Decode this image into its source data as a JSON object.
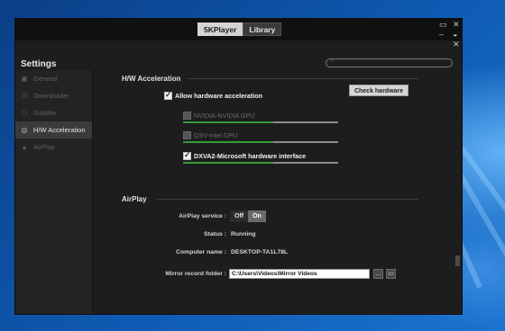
{
  "topbar": {
    "tabs": [
      {
        "label": "5KPlayer",
        "active": true
      },
      {
        "label": "Library",
        "active": false
      }
    ],
    "controls": [
      "minimize-icon",
      "close-icon",
      "maximize-icon",
      "dropdown-icon",
      "close-icon"
    ]
  },
  "settings": {
    "title": "Settings",
    "search_placeholder": ""
  },
  "sidebar": {
    "items": [
      {
        "label": "General",
        "icon": "gear-icon",
        "active": false
      },
      {
        "label": "Downloader",
        "icon": "download-icon",
        "active": false
      },
      {
        "label": "Subtitle",
        "icon": "subtitle-icon",
        "active": false
      },
      {
        "label": "H/W Acceleration",
        "icon": "hw-acceleration-icon",
        "active": true
      },
      {
        "label": "AirPlay",
        "icon": "airplay-icon",
        "active": false
      }
    ]
  },
  "hw": {
    "title": "H/W Acceleration",
    "allow_label": "Allow hardware acceleration",
    "allow_checked": true,
    "check_button": "Check hardware",
    "options": [
      {
        "label": "NVIDIA-NVIDIA GPU",
        "checked": false,
        "enabled": false,
        "level": 0.58
      },
      {
        "label": "QSV-Intel GPU",
        "checked": false,
        "enabled": false,
        "level": 0.58
      },
      {
        "label": "DXVA2-Microsoft hardware interface",
        "checked": true,
        "enabled": true,
        "level": 0.58
      }
    ]
  },
  "airplay": {
    "title": "AirPlay",
    "service_label": "AirPlay service :",
    "service_off": "Off",
    "service_on": "On",
    "service_state": "On",
    "status_label": "Status :",
    "status_value": "Running",
    "computer_label": "Computer name :",
    "computer_value": "DESKTOP-TA1L78L",
    "mirror_label": "Mirror record folder :",
    "mirror_value": "C:\\Users\\Videos\\Mirror Videos",
    "open_folder_icon": "folder-icon",
    "browse_icon": "browse-icon"
  },
  "colors": {
    "accent_green": "#3a9a3a",
    "window_bg": "#1d1d1f",
    "desktop_blue": "#0e5bb3"
  }
}
